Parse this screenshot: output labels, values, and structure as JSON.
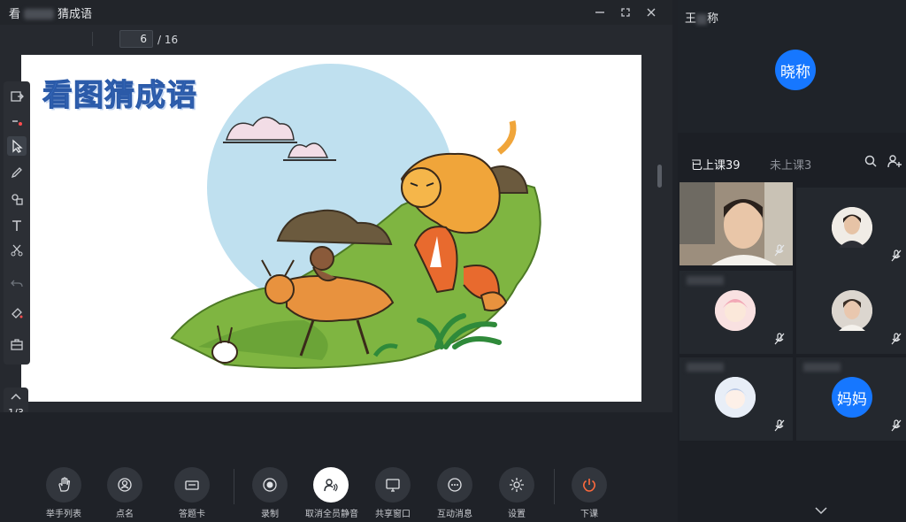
{
  "window": {
    "title_prefix": "看",
    "title_suffix": "猜成语"
  },
  "toolbar": {
    "current_page": "6",
    "total_pages": "/ 16"
  },
  "slide": {
    "title": "看图猜成语",
    "image_alt": "狐假虎威插图"
  },
  "side_nav": {
    "indicator": "1/3"
  },
  "teacher": {
    "name_prefix": "王",
    "name_suffix": "称",
    "avatar_text": "晓称"
  },
  "tabs": {
    "attended": "已上课39",
    "absent": "未上课3"
  },
  "students": [
    {
      "avatar": "video",
      "muted": true
    },
    {
      "avatar": "photo",
      "muted": true
    },
    {
      "avatar": "photo",
      "muted": true
    },
    {
      "avatar": "photo",
      "muted": true
    },
    {
      "avatar": "photo",
      "muted": true
    },
    {
      "avatar": "text",
      "avatar_text": "妈妈",
      "muted": true
    }
  ],
  "controls": [
    {
      "label": "举手列表",
      "icon": "hand-icon"
    },
    {
      "label": "点名",
      "icon": "roll-call-icon"
    },
    {
      "label": "答题卡",
      "icon": "answer-card-icon"
    },
    {
      "label": "录制",
      "icon": "record-icon"
    },
    {
      "label": "取消全员静音",
      "icon": "unmute-all-icon"
    },
    {
      "label": "共享窗口",
      "icon": "share-window-icon"
    },
    {
      "label": "互动消息",
      "icon": "chat-icon"
    },
    {
      "label": "设置",
      "icon": "settings-icon"
    },
    {
      "label": "下课",
      "icon": "power-icon"
    }
  ],
  "colors": {
    "accent": "#1677ff",
    "end_class": "#ff6a3d",
    "title_blue": "#3a6fc4"
  }
}
